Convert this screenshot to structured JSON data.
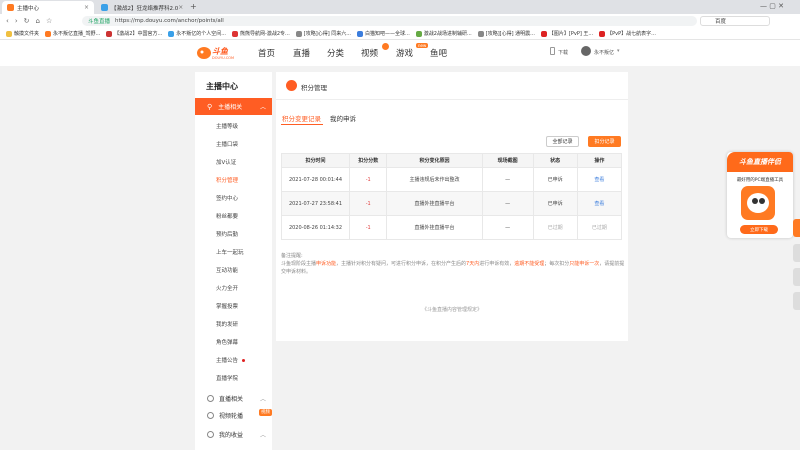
{
  "browser": {
    "tabs": [
      {
        "title": "主播中心",
        "close": "×"
      },
      {
        "title": "【激战2】狂龙络推荐科2.0",
        "close": "×"
      }
    ],
    "new_tab": "+",
    "nav": {
      "back": "‹",
      "forward": "›",
      "reload": "↻",
      "home": "⌂",
      "favorite": "☆"
    },
    "url_site": "斗鱼直播",
    "url_path": "https://mp.douyu.com/anchor/points/all",
    "search_value": "百度",
    "bookmarks": [
      "触摸文件夹",
      "永不叛亿直播_驾野...",
      "【激战2】中国官方...",
      "永不叛亿的个人空间...",
      "熊熊导航网-激战2专...",
      "[攻略]心得] 同来六...",
      "白猫知吧——全球...",
      "激战2战场进制辅研...",
      "[攻略][心得] 通明震...",
      "【图片】[PvP] 王...",
      "【PvP】战七航表字..."
    ]
  },
  "site": {
    "logo_text": "斗鱼",
    "logo_sub": "DOUYU.COM",
    "nav": [
      "首页",
      "直播",
      "分类",
      "视频",
      "游戏",
      "鱼吧"
    ],
    "new_badge": "new",
    "download": "下载",
    "username": "永不叛亿"
  },
  "sidebar": {
    "title": "主播中心",
    "group_active": "主播相关",
    "items": [
      "主播等级",
      "主播口袋",
      "加V认证",
      "积分管理",
      "签约中心",
      "粉丝都要",
      "预约后勤",
      "上车一起玩",
      "互动功能",
      "火力全开",
      "掌握投票",
      "我的发研",
      "角色弹幕",
      "主播公告",
      "直播学院"
    ],
    "groups": [
      "直播相关",
      "视频轮播",
      "我的收益"
    ],
    "video_badge": "视频"
  },
  "content": {
    "page_title": "积分管理",
    "tabs": [
      "积分变更记录",
      "我的申诉"
    ],
    "btn_all": "全部记录",
    "btn_deduct": "扣分记录",
    "columns": [
      "扣分时间",
      "扣分分数",
      "积分变化原因",
      "现场截图",
      "状态",
      "操作"
    ],
    "rows": [
      {
        "time": "2021-07-28 00:01:44",
        "score": "-1",
        "reason": "主播违规后未作出整改",
        "shot": "—",
        "status": "已申诉",
        "action": "查看"
      },
      {
        "time": "2021-07-27 23:58:41",
        "score": "-1",
        "reason": "直播外挂直播平台",
        "shot": "—",
        "status": "已申诉",
        "action": "查看"
      },
      {
        "time": "2020-08-26 01:14:32",
        "score": "-1",
        "reason": "直播外挂直播平台",
        "shot": "—",
        "status": "已过期",
        "action": "已过期"
      }
    ],
    "notes_title": "备注提醒:",
    "notes_1": "斗鱼现阶段主播",
    "notes_1o": "申诉功能",
    "notes_2": "，主播针对积分有疑问，可进行积分申诉，在积分产生后的",
    "notes_2o": "7天内",
    "notes_3": "进行申诉有效，",
    "notes_3o": "逾期不能受理",
    "notes_4": "；每次扣分",
    "notes_4o": "只能申诉一次",
    "notes_5": "，请提前提交申诉材料。",
    "footer": "《斗鱼直播内容管理规定》"
  },
  "ad": {
    "title": "斗鱼直播伴侣",
    "subtitle": "最好用的PC端直播工具",
    "button": "立即下载"
  },
  "colors": {
    "accent": "#ff5d23",
    "link": "#3b7ddd",
    "negative": "#e04040"
  }
}
